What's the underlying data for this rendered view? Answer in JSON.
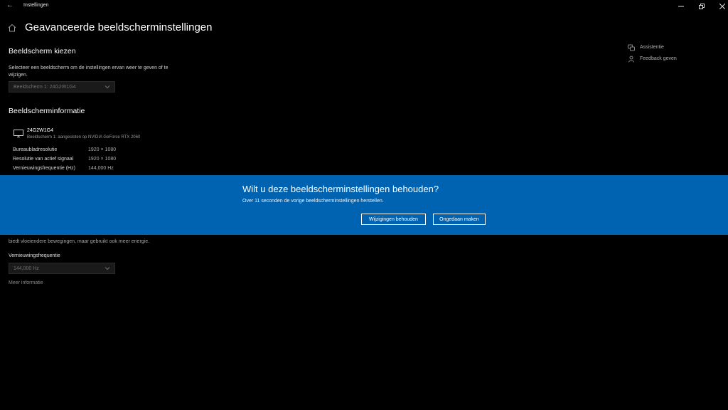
{
  "window": {
    "title": "Instellingen"
  },
  "page": {
    "title": "Geavanceerde beeldscherminstellingen"
  },
  "display_select": {
    "heading": "Beeldscherm kiezen",
    "description_line1": "Selecteer een beeldscherm om de instellingen ervan weer te geven of te",
    "description_line2": "wijzigen.",
    "value": "Beeldscherm 1: 24G2W1G4"
  },
  "display_info": {
    "heading": "Beeldscherminformatie",
    "monitor_name": "24G2W1G4",
    "monitor_sub": "Beeldscherm 1: aangesloten op NVIDIA GeForce RTX 2060",
    "rows": [
      {
        "label": "Bureaubladresolutie",
        "value": "1920 × 1080"
      },
      {
        "label": "Resolutie van actief signaal",
        "value": "1920 × 1080"
      },
      {
        "label": "Vernieuwingsfrequentie (Hz)",
        "value": "144,000 Hz"
      }
    ]
  },
  "refresh": {
    "partial_line": "biedt vloeiendere bewegingen, maar gebruikt ook meer energie.",
    "label": "Vernieuwingsfrequentie",
    "value": "144,000 Hz",
    "more_info": "Meer informatie"
  },
  "help": {
    "assistance": "Assistentie",
    "feedback": "Feedback geven"
  },
  "dialog": {
    "title": "Wilt u deze beeldscherminstellingen behouden?",
    "text": "Over 11 seconden de vorige beeldscherminstellingen herstellen.",
    "keep_label": "Wijzigingen behouden",
    "undo_label": "Ongedaan maken"
  },
  "colors": {
    "banner": "#0063b1",
    "background": "#000000"
  }
}
